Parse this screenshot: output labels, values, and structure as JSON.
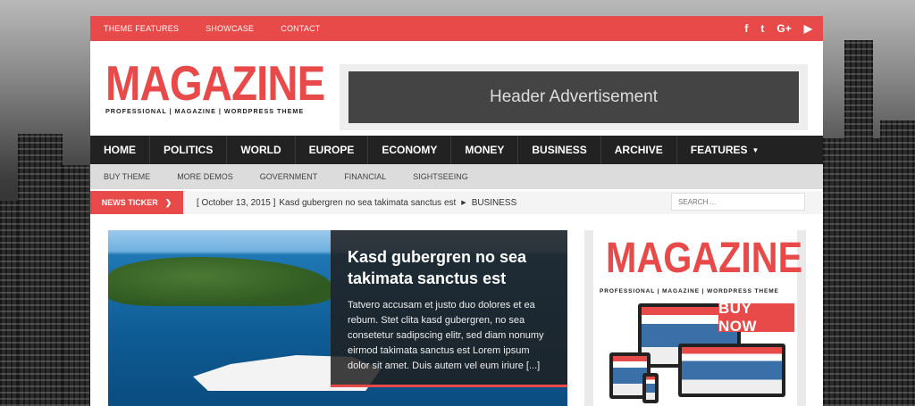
{
  "topbar": {
    "nav": [
      "THEME FEATURES",
      "SHOWCASE",
      "CONTACT"
    ],
    "social": {
      "facebook": "f",
      "twitter": "t",
      "googleplus": "G+",
      "youtube": "▶"
    }
  },
  "header": {
    "logo": "MAGAZINE",
    "tagline": "PROFESSIONAL | MAGAZINE | WORDPRESS THEME",
    "ad": "Header Advertisement"
  },
  "mainnav": [
    "HOME",
    "POLITICS",
    "WORLD",
    "EUROPE",
    "ECONOMY",
    "MONEY",
    "BUSINESS",
    "ARCHIVE",
    "FEATURES"
  ],
  "subnav": [
    "BUY THEME",
    "MORE DEMOS",
    "GOVERNMENT",
    "FINANCIAL",
    "SIGHTSEEING"
  ],
  "ticker": {
    "label": "NEWS TICKER",
    "date": "[ October 13, 2015 ]",
    "headline": "Kasd gubergren no sea takimata sanctus est",
    "category": "BUSINESS",
    "search_placeholder": "SEARCH ..."
  },
  "featured": {
    "title": "Kasd gubergren no sea takimata sanctus est",
    "excerpt": "Tatvero accusam et justo duo dolores et ea rebum. Stet clita kasd gubergren, no sea consetetur sadipscing elitr, sed diam nonumy eirmod takimata sanctus est Lorem ipsum dolor sit amet. Duis autem vel eum iriure [...]"
  },
  "sidebar_ad": {
    "logo": "MAGAZINE",
    "tagline": "PROFESSIONAL | MAGAZINE | WORDPRESS THEME",
    "button": "BUY NOW"
  },
  "colors": {
    "accent": "#e74a48",
    "dark": "#222222",
    "subnav": "#dcdcdc"
  }
}
